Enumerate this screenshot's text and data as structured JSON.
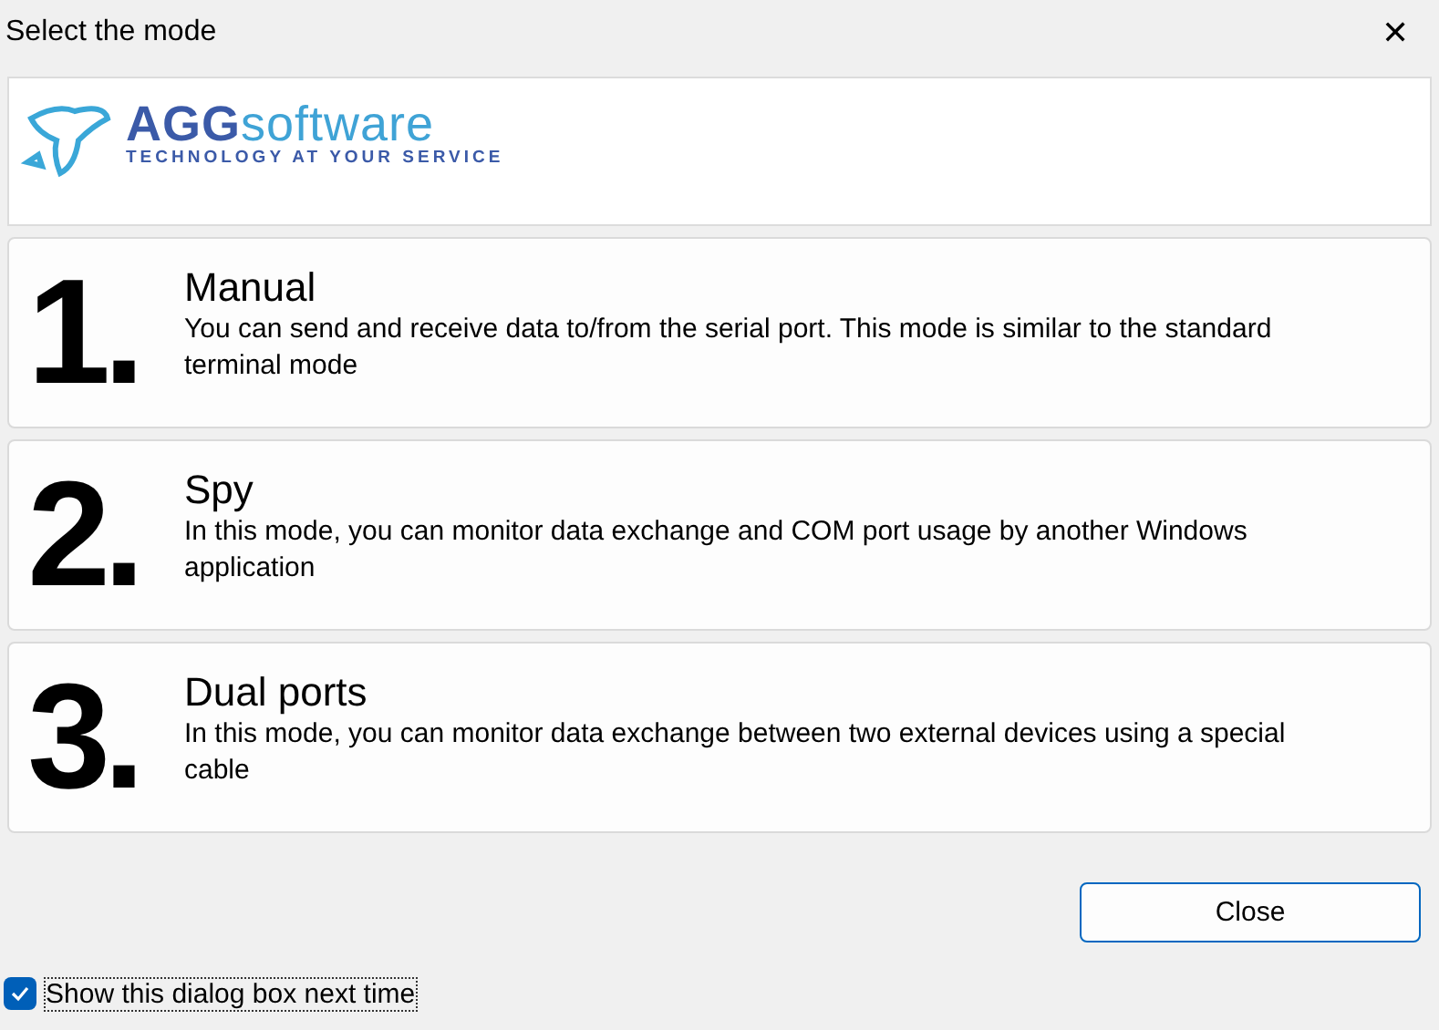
{
  "window": {
    "title": "Select the mode",
    "close": "✕"
  },
  "logo": {
    "name": "**AGG**software",
    "tagline": "TECHNOLOGY AT YOUR SERVICE"
  },
  "modes": [
    {
      "number": "1.",
      "title": "Manual",
      "description": "You can send and receive data to/from the serial port. This mode is similar to the standard terminal mode"
    },
    {
      "number": "2.",
      "title": "Spy",
      "description": "In this mode, you can monitor data exchange and COM port usage by another Windows application"
    },
    {
      "number": "3.",
      "title": "Dual ports",
      "description": "In this mode, you can monitor data exchange between two external devices using a special cable"
    }
  ],
  "buttons": [
    "Close"
  ],
  "show_next_time": {
    "label": "Show this dialog box next time",
    "checked": true
  }
}
